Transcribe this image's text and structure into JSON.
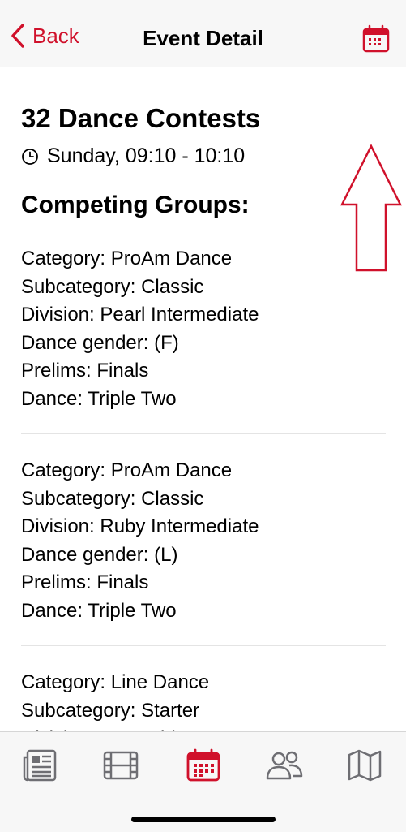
{
  "nav": {
    "back_label": "Back",
    "title": "Event Detail"
  },
  "event": {
    "title": "32 Dance Contests",
    "time": "Sunday, 09:10 - 10:10"
  },
  "groups_heading": "Competing Groups:",
  "groups": [
    {
      "lines": [
        "Category: ProAm Dance",
        "Subcategory: Classic",
        "Division: Pearl Intermediate",
        "Dance gender: (F)",
        "Prelims: Finals",
        "Dance: Triple Two"
      ]
    },
    {
      "lines": [
        "Category: ProAm Dance",
        "Subcategory: Classic",
        "Division: Ruby Intermediate",
        "Dance gender: (L)",
        "Prelims: Finals",
        "Dance: Triple Two"
      ]
    },
    {
      "lines": [
        "Category: Line Dance",
        "Subcategory: Starter",
        "Division: Ensemble"
      ]
    }
  ],
  "tabs": [
    {
      "icon": "news-icon",
      "active": false
    },
    {
      "icon": "film-icon",
      "active": false
    },
    {
      "icon": "calendar-icon",
      "active": true
    },
    {
      "icon": "people-icon",
      "active": false
    },
    {
      "icon": "map-icon",
      "active": false
    }
  ],
  "colors": {
    "accent": "#d0112b",
    "inactive_icon": "#6e6e73",
    "annotation_arrow": "#d0112b"
  }
}
